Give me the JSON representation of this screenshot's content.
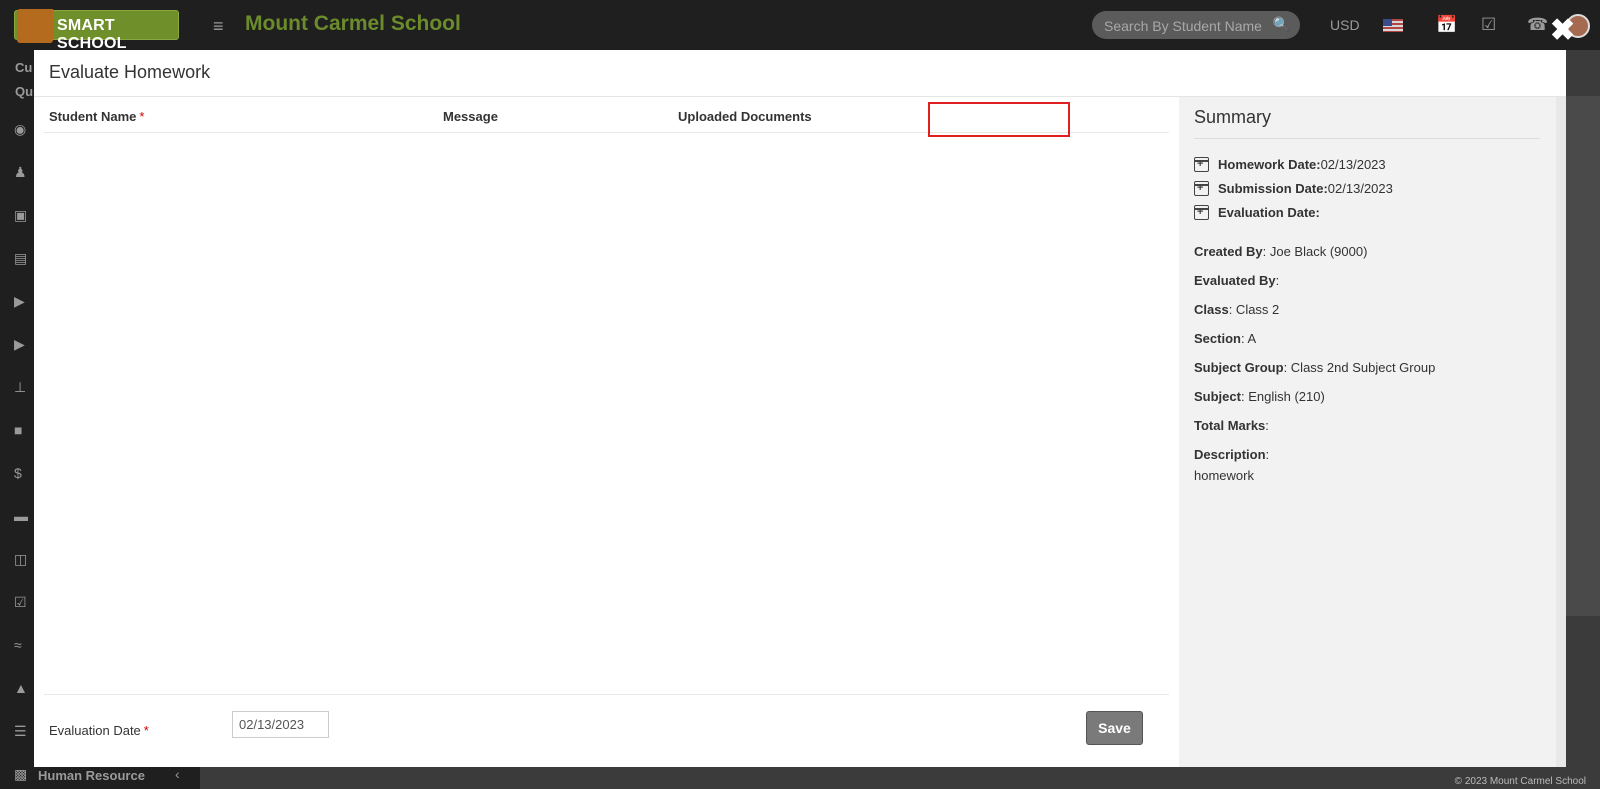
{
  "app": {
    "logo_text": "SMART SCHOOL",
    "school_name": "Mount Carmel School",
    "search_placeholder": "Search By Student Name",
    "currency": "USD",
    "sidebar_partial_1": "Cu",
    "sidebar_partial_2": "Qu",
    "sidebar_bottom_label": "Human Resource",
    "footer": "© 2023 Mount Carmel School"
  },
  "modal": {
    "title": "Evaluate Homework",
    "table": {
      "col_student": "Student Name",
      "col_message": "Message",
      "col_documents": "Uploaded Documents",
      "required_mark": "*"
    },
    "footer": {
      "evaluation_label": "Evaluation Date",
      "evaluation_value": "02/13/2023",
      "save_label": "Save"
    }
  },
  "summary": {
    "title": "Summary",
    "homework_date_label": "Homework Date:",
    "homework_date": "02/13/2023",
    "submission_date_label": "Submission Date:",
    "submission_date": "02/13/2023",
    "evaluation_date_label": "Evaluation Date:",
    "created_by_label": "Created By",
    "created_by": ": Joe Black (9000)",
    "evaluated_by_label": "Evaluated By",
    "evaluated_by": ":",
    "class_label": "Class",
    "class": ": Class 2",
    "section_label": "Section",
    "section": ": A",
    "subject_group_label": "Subject Group",
    "subject_group": ": Class 2nd Subject Group",
    "subject_label": "Subject",
    "subject": ": English (210)",
    "total_marks_label": "Total Marks",
    "total_marks": ":",
    "description_label": "Description",
    "description_colon": ":",
    "description": "homework"
  }
}
